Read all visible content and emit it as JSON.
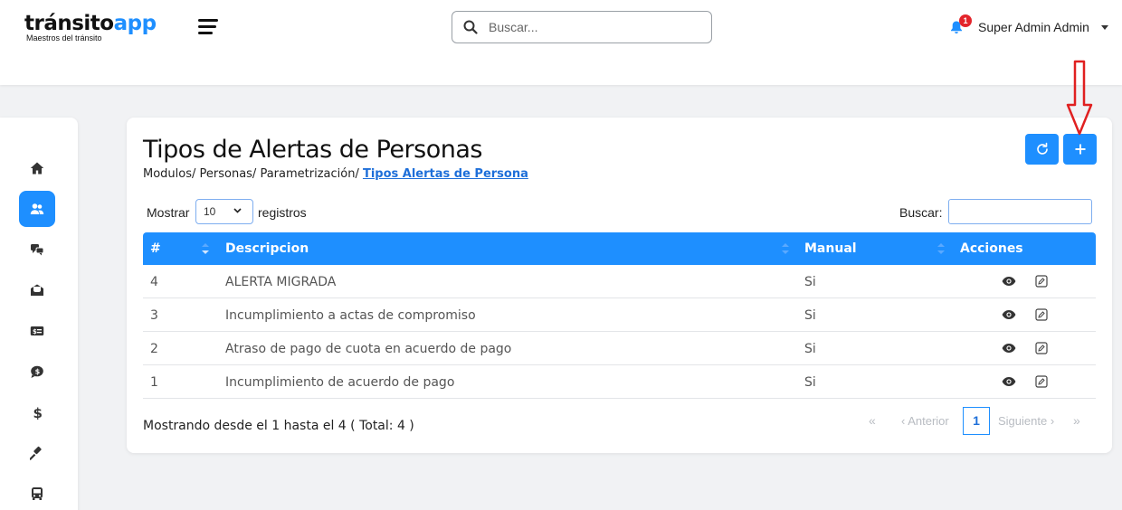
{
  "header": {
    "logo_main_a": "tránsito",
    "logo_main_b": "app",
    "logo_sub": "Maestros del tránsito",
    "search_placeholder": "Buscar...",
    "notification_count": "1",
    "user_name": "Super Admin Admin"
  },
  "sidebar": {
    "items": [
      {
        "icon": "home-icon",
        "active": false
      },
      {
        "icon": "users-icon",
        "active": true
      },
      {
        "icon": "chat-icon",
        "active": false
      },
      {
        "icon": "mail-open-icon",
        "active": false
      },
      {
        "icon": "id-card-icon",
        "active": false
      },
      {
        "icon": "comment-dollar-icon",
        "active": false
      },
      {
        "icon": "dollar-icon",
        "active": false
      },
      {
        "icon": "gavel-icon",
        "active": false
      },
      {
        "icon": "bus-icon",
        "active": false
      }
    ]
  },
  "page": {
    "title": "Tipos de Alertas de Personas",
    "breadcrumb_path": "Modulos/ Personas/ Parametrización/ ",
    "breadcrumb_current": "Tipos Alertas de Persona"
  },
  "controls": {
    "show_label": "Mostrar",
    "page_size": "10",
    "records_label": "registros",
    "search_label": "Buscar:"
  },
  "table": {
    "headers": {
      "num": "#",
      "description": "Descripcion",
      "manual": "Manual",
      "actions": "Acciones"
    },
    "rows": [
      {
        "num": "4",
        "description": "ALERTA MIGRADA",
        "manual": "Si"
      },
      {
        "num": "3",
        "description": "Incumplimiento a actas de compromiso",
        "manual": "Si"
      },
      {
        "num": "2",
        "description": "Atraso de pago de cuota en acuerdo de pago",
        "manual": "Si"
      },
      {
        "num": "1",
        "description": "Incumplimiento de acuerdo de pago",
        "manual": "Si"
      }
    ]
  },
  "footer": {
    "info": "Mostrando desde el 1 hasta el 4 ( Total: 4 )",
    "first": "«",
    "prev": "‹ Anterior",
    "current_page": "1",
    "next": "Siguiente ›",
    "last": "»"
  },
  "colors": {
    "accent": "#1e8fff",
    "badge": "#e3242b",
    "annotation_arrow": "#e02020"
  }
}
